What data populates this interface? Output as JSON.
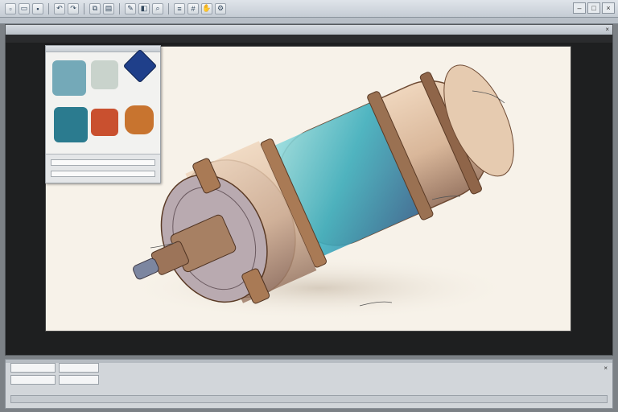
{
  "toolbar": {
    "buttons": [
      "new-icon",
      "open-icon",
      "save-icon",
      "undo-icon",
      "redo-icon",
      "copy-icon",
      "paste-icon",
      "brush-icon",
      "eraser-icon",
      "zoom-icon",
      "layers-icon",
      "grid-icon",
      "hand-icon",
      "settings-icon"
    ]
  },
  "window": {
    "minimize": "–",
    "maximize": "□",
    "close": "×"
  },
  "document": {
    "close": "×"
  },
  "swatches": [
    {
      "name": "teal-wash",
      "color": "#74a9b8"
    },
    {
      "name": "pale-sage",
      "color": "#c9d3cc"
    },
    {
      "name": "cobalt-blue",
      "color": "#1f3f8a"
    },
    {
      "name": "deep-teal",
      "color": "#2b7b8f"
    },
    {
      "name": "vermilion",
      "color": "#c9502f"
    },
    {
      "name": "burnt-orange",
      "color": "#c8742f"
    }
  ],
  "colors": {
    "paper": "#f7f2e9",
    "workspace": "#1e1f20",
    "chrome": "#c5ccd4"
  }
}
